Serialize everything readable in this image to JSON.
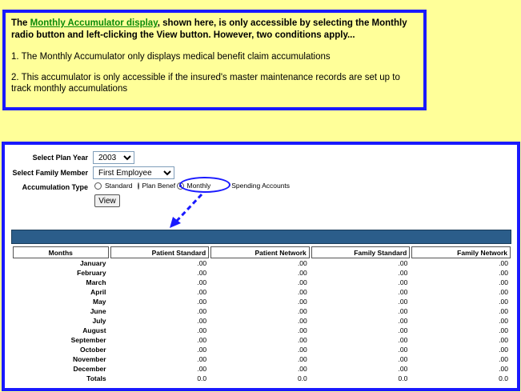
{
  "callout": {
    "lead_prefix": "The ",
    "lead_link": "Monthly Accumulator display",
    "lead_suffix": ", shown here, is only accessible by selecting the Monthly radio button and left-clicking the View button.  However, two conditions apply...",
    "condition1": "1. The Monthly Accumulator only displays medical benefit claim accumulations",
    "condition2": "2. This accumulator is only accessible if the insured's master maintenance records are set up to track monthly accumulations"
  },
  "form": {
    "plan_year_label": "Select Plan Year",
    "plan_year_value": "2003",
    "family_member_label": "Select Family Member",
    "family_member_value": "First Employee",
    "accumulation_label": "Accumulation Type",
    "radio_standard": "Standard",
    "radio_plan_benefit": "Plan Benefit",
    "radio_monthly": "Monthly",
    "radio_spending": "Spending Accounts",
    "selected_radio": "Monthly",
    "view_button": "View"
  },
  "table": {
    "headers": [
      "Months",
      "Patient Standard",
      "Patient Network",
      "Family Standard",
      "Family Network"
    ],
    "rows": [
      [
        "January",
        ".00",
        ".00",
        ".00",
        ".00"
      ],
      [
        "February",
        ".00",
        ".00",
        ".00",
        ".00"
      ],
      [
        "March",
        ".00",
        ".00",
        ".00",
        ".00"
      ],
      [
        "April",
        ".00",
        ".00",
        ".00",
        ".00"
      ],
      [
        "May",
        ".00",
        ".00",
        ".00",
        ".00"
      ],
      [
        "June",
        ".00",
        ".00",
        ".00",
        ".00"
      ],
      [
        "July",
        ".00",
        ".00",
        ".00",
        ".00"
      ],
      [
        "August",
        ".00",
        ".00",
        ".00",
        ".00"
      ],
      [
        "September",
        ".00",
        ".00",
        ".00",
        ".00"
      ],
      [
        "October",
        ".00",
        ".00",
        ".00",
        ".00"
      ],
      [
        "November",
        ".00",
        ".00",
        ".00",
        ".00"
      ],
      [
        "December",
        ".00",
        ".00",
        ".00",
        ".00"
      ],
      [
        "Totals",
        "0.0",
        "0.0",
        "0.0",
        "0.0"
      ]
    ]
  },
  "colors": {
    "page_background": "#FFFF99",
    "border_blue": "#1a1aff",
    "link_green": "#0a8a0a",
    "header_bar": "#2b5d8a"
  },
  "icons": {
    "arrow": "dashed-arrow-icon",
    "dropdown": "chevron-down-icon"
  }
}
